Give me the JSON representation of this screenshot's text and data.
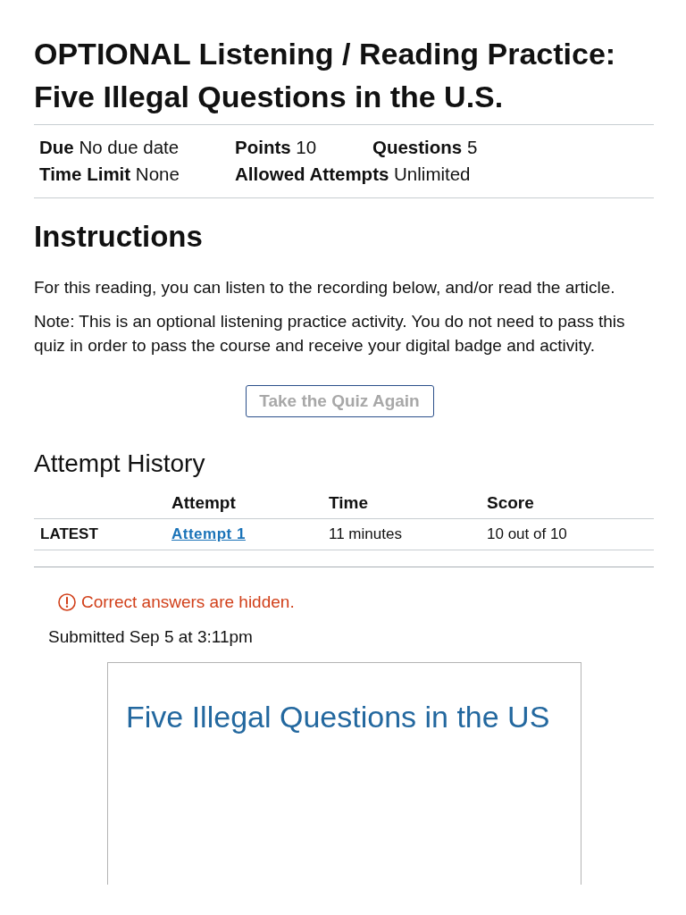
{
  "title": "OPTIONAL Listening / Reading Practice: Five Illegal Questions in the U.S.",
  "details": [
    [
      {
        "label": "Due",
        "value": "No due date"
      },
      {
        "label": "Points",
        "value": "10"
      },
      {
        "label": "Questions",
        "value": "5"
      }
    ],
    [
      {
        "label": "Time Limit",
        "value": "None"
      },
      {
        "label": "Allowed Attempts",
        "value": "Unlimited"
      }
    ]
  ],
  "instructions": {
    "heading": "Instructions",
    "paragraphs": [
      "For this reading, you can listen to the recording below, and/or read the article.",
      "Note: This is an optional listening practice activity. You do not need to pass this quiz in order to pass the course and receive your digital badge and activity."
    ]
  },
  "quiz_button": {
    "label": "Take the Quiz Again"
  },
  "attempt_history": {
    "heading": "Attempt History",
    "columns": [
      "Attempt",
      "Time",
      "Score"
    ],
    "rows": [
      {
        "status": "LATEST",
        "attempt": "Attempt 1",
        "time": "11 minutes",
        "score": "10 out of 10"
      }
    ]
  },
  "notice": {
    "kind": "warning",
    "text": "Correct answers are hidden."
  },
  "submitted": "Submitted Sep 5 at 3:11pm",
  "embedded_content": {
    "title": "Five Illegal Questions in the US"
  }
}
